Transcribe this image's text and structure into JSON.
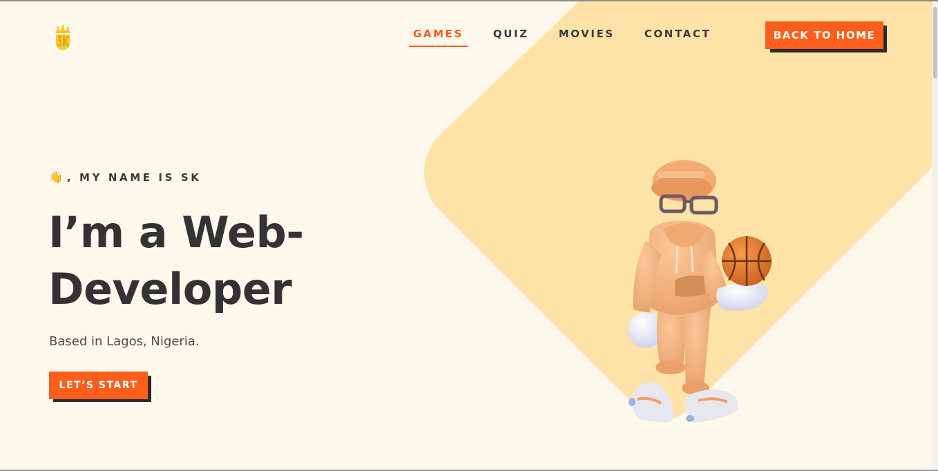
{
  "header": {
    "logo_label": "SK",
    "nav": [
      {
        "label": "GAMES",
        "active": true
      },
      {
        "label": "QUIZ",
        "active": false
      },
      {
        "label": "MOVIES",
        "active": false
      },
      {
        "label": "CONTACT",
        "active": false
      }
    ],
    "back_button_label": "BACK TO HOME"
  },
  "hero": {
    "greeting_emoji": "👋",
    "greeting": ", MY NAME IS SK",
    "headline_line1": "I’m a Web-",
    "headline_line2": "Developer",
    "location": "Based in Lagos, Nigeria.",
    "cta_label": "LET’S START"
  },
  "colors": {
    "background": "#fef8ec",
    "accent": "#fd5e1c",
    "diamond": "#fee3a8",
    "text": "#333333",
    "button_shadow": "#2b2b2b"
  },
  "icons": {
    "logo": "crown-sk-logo-icon",
    "character": "3d-character-with-basketball-illustration"
  }
}
